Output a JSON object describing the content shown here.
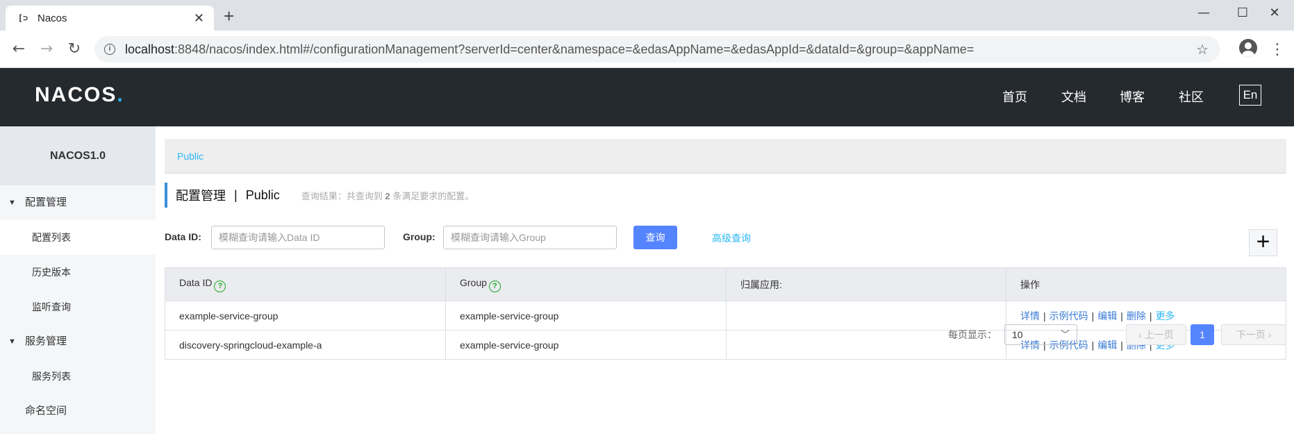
{
  "browser": {
    "tab_title": "Nacos",
    "tab_close": "✕",
    "new_tab": "+",
    "url_host": "localhost",
    "url_rest": ":8848/nacos/index.html#/configurationManagement?serverId=center&namespace=&edasAppName=&edasAppId=&dataId=&group=&appName="
  },
  "header": {
    "logo_text": "NACOS",
    "logo_dot": ".",
    "nav": [
      "首页",
      "文档",
      "博客",
      "社区"
    ],
    "lang": "En"
  },
  "sidebar": {
    "title": "NACOS1.0",
    "groups": [
      {
        "label": "配置管理",
        "items": [
          "配置列表",
          "历史版本",
          "监听查询"
        ]
      },
      {
        "label": "服务管理",
        "items": [
          "服务列表"
        ]
      }
    ],
    "namespace": "命名空间"
  },
  "main": {
    "breadcrumb": "Public",
    "page_title": "配置管理",
    "title_sep": "|",
    "namespace_name": "Public",
    "result_prefix": "查询结果：共查询到",
    "result_count": "2",
    "result_suffix": "条满足要求的配置。",
    "dataid_label": "Data ID:",
    "dataid_placeholder": "模糊查询请输入Data ID",
    "group_label": "Group:",
    "group_placeholder": "模糊查询请输入Group",
    "query_btn": "查询",
    "advanced_query": "高级查询",
    "add_btn": "+"
  },
  "table": {
    "headers": {
      "data_id": "Data ID",
      "group": "Group",
      "app": "归属应用:",
      "ops": "操作"
    },
    "rows": [
      {
        "data_id": "example-service-group",
        "group": "example-service-group",
        "app": ""
      },
      {
        "data_id": "discovery-springcloud-example-a",
        "group": "example-service-group",
        "app": ""
      }
    ],
    "ops": {
      "detail": "详情",
      "sample": "示例代码",
      "edit": "编辑",
      "delete": "删除",
      "more": "更多",
      "sep": "|"
    }
  },
  "pagination": {
    "page_size_label": "每页显示：",
    "page_size": "10",
    "prev": "上一页",
    "current": "1",
    "next": "下一页"
  },
  "colors": {
    "header_bg": "#252a2f",
    "accent_blue": "#5584ff",
    "link_cyan": "#2bb7f3",
    "help_green": "#1aaa24"
  }
}
